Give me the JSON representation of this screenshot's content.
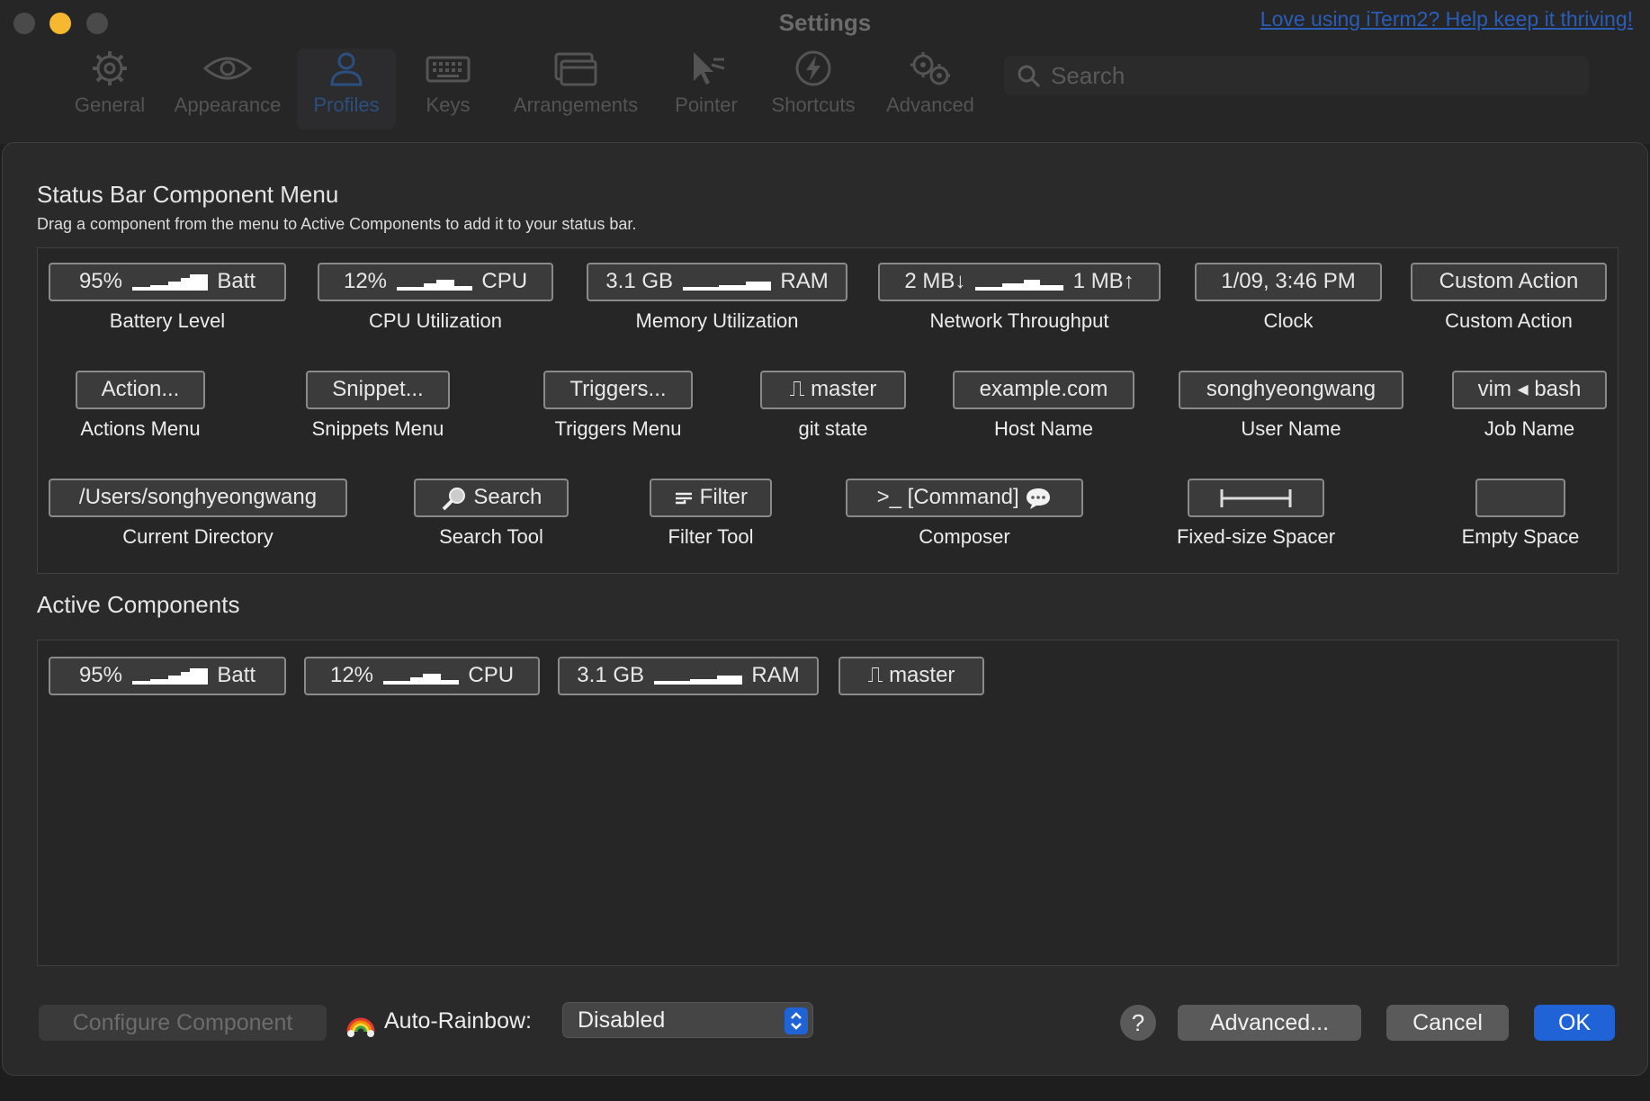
{
  "window": {
    "title": "Settings",
    "donate_link": "Love using iTerm2? Help keep it thriving!"
  },
  "toolbar": {
    "items": [
      {
        "label": "General",
        "icon": "gear-icon"
      },
      {
        "label": "Appearance",
        "icon": "eye-icon"
      },
      {
        "label": "Profiles",
        "icon": "person-icon",
        "selected": true
      },
      {
        "label": "Keys",
        "icon": "keyboard-icon"
      },
      {
        "label": "Arrangements",
        "icon": "windows-icon"
      },
      {
        "label": "Pointer",
        "icon": "cursor-icon"
      },
      {
        "label": "Shortcuts",
        "icon": "bolt-icon"
      },
      {
        "label": "Advanced",
        "icon": "gears-icon"
      }
    ],
    "search_placeholder": "Search"
  },
  "sheet": {
    "title": "Status Bar Component Menu",
    "description": "Drag a component from the menu to Active Components to add it to your status bar.",
    "active_title": "Active Components"
  },
  "palette": {
    "battery": {
      "pre": "95%",
      "post": "Batt",
      "caption": "Battery Level"
    },
    "cpu": {
      "pre": "12%",
      "post": "CPU",
      "caption": "CPU Utilization"
    },
    "memory": {
      "pre": "3.1 GB",
      "post": "RAM",
      "caption": "Memory Utilization"
    },
    "network": {
      "pre": "2 MB↓",
      "post": "1 MB↑",
      "caption": "Network Throughput"
    },
    "clock": {
      "text": "1/09, 3:46 PM",
      "caption": "Clock"
    },
    "custom_action": {
      "text": "Custom Action",
      "caption": "Custom Action"
    },
    "actions": {
      "text": "Action...",
      "caption": "Actions Menu"
    },
    "snippets": {
      "text": "Snippet...",
      "caption": "Snippets Menu"
    },
    "triggers": {
      "text": "Triggers...",
      "caption": "Triggers Menu"
    },
    "git": {
      "glyph": "⎍",
      "text": "master",
      "caption": "git state"
    },
    "host": {
      "text": "example.com",
      "caption": "Host Name"
    },
    "user": {
      "text": "songhyeongwang",
      "caption": "User Name"
    },
    "job": {
      "text": "vim ◂ bash",
      "caption": "Job Name"
    },
    "directory": {
      "text": "/Users/songhyeongwang",
      "caption": "Current Directory"
    },
    "search": {
      "text": "Search",
      "caption": "Search Tool"
    },
    "filter": {
      "text": "Filter",
      "caption": "Filter Tool"
    },
    "composer": {
      "text": ">_ [Command]",
      "caption": "Composer"
    },
    "spacer": {
      "caption": "Fixed-size Spacer"
    },
    "empty": {
      "caption": "Empty Space"
    }
  },
  "active": {
    "battery": {
      "pre": "95%",
      "post": "Batt"
    },
    "cpu": {
      "pre": "12%",
      "post": "CPU"
    },
    "memory": {
      "pre": "3.1 GB",
      "post": "RAM"
    },
    "git": {
      "text": "master"
    }
  },
  "controls": {
    "configure": "Configure Component",
    "rainbow_label": "Auto-Rainbow:",
    "rainbow_value": "Disabled",
    "help": "?",
    "advanced": "Advanced...",
    "cancel": "Cancel",
    "ok": "OK"
  },
  "colors": {
    "accent": "#1f63d6",
    "link": "#2a5db8"
  }
}
